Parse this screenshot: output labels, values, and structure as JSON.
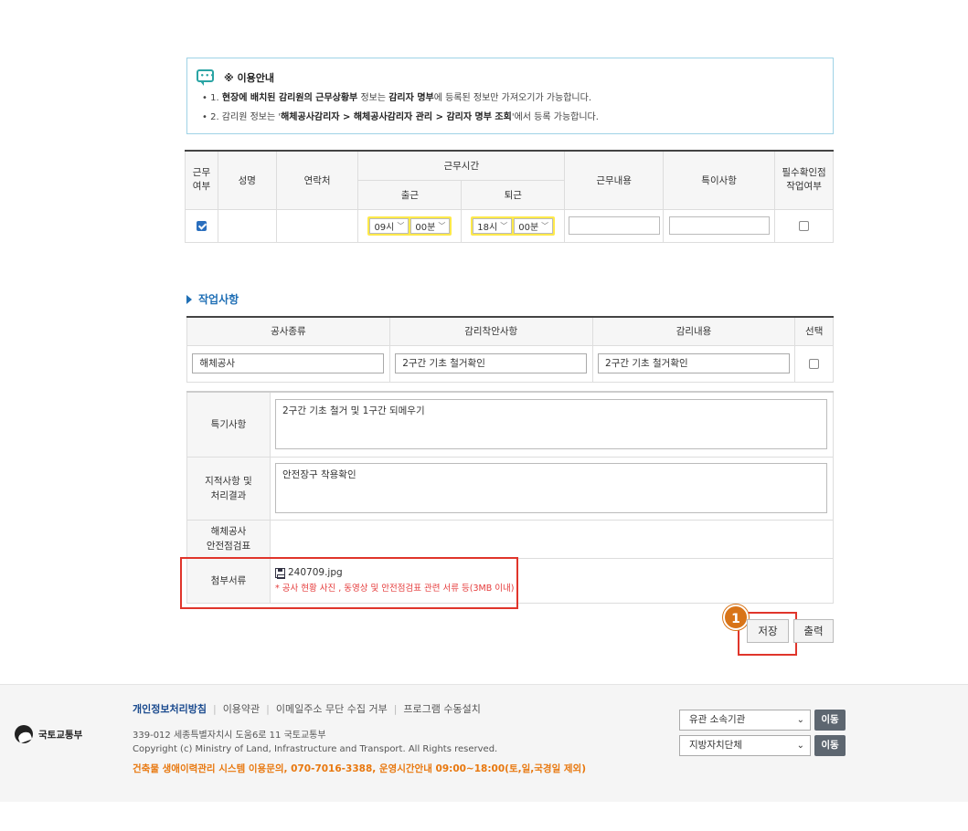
{
  "notice": {
    "title": "※ 이용안내",
    "line1": {
      "prefix": "1. ",
      "b1": "현장에 배치된 감리원의 근무상황부",
      "t1": " 정보는 ",
      "b2": "감리자 명부",
      "t2": "에 등록된 정보만 가져오기가 가능합니다."
    },
    "line2": {
      "prefix": "2. 감리원 정보는 '",
      "b1": "해체공사감리자 > 해체공사감리자 관리 > 감리자 명부 조회",
      "t1": "'에서 등록 가능합니다."
    }
  },
  "worktable": {
    "headers": {
      "work": "근무\n여부",
      "name": "성명",
      "contact": "연락처",
      "time": "근무시간",
      "in": "출근",
      "out": "퇴근",
      "content": "근무내용",
      "special": "특이사항",
      "required": "필수확인점\n작업여부"
    },
    "row": {
      "checked": true,
      "in_hour": "09시",
      "in_min": "00분",
      "out_hour": "18시",
      "out_min": "00분"
    }
  },
  "section_title": "작업사항",
  "tasktable": {
    "headers": [
      "공사종류",
      "감리착안사항",
      "감리내용",
      "선택"
    ],
    "row": [
      "해체공사",
      "2구간 기초 철거확인",
      "2구간 기초 철거확인"
    ]
  },
  "details": {
    "special_label": "특기사항",
    "special_value": "2구간 기초 철거 및 1구간 되메우기",
    "issue_label_1": "지적사항 및",
    "issue_label_2": "처리결과",
    "issue_value": "안전장구 착용확인",
    "safety_label_1": "해체공사",
    "safety_label_2": "안전점검표",
    "attach_label": "첨부서류",
    "file_name": "240709.jpg",
    "file_note": "* 공사 현황 사진 , 동영상 및 안전점검표 관련 서류 등(3MB 이내)"
  },
  "badge": "1",
  "buttons": {
    "save": "저장",
    "print": "출력"
  },
  "footer": {
    "logo_text": "국토교통부",
    "links": [
      "개인정보처리방침",
      "이용약관",
      "이메일주소 무단 수집 거부",
      "프로그램 수동설치"
    ],
    "address": "339-012 세종특별자치시 도움6로 11 국토교통부",
    "copyright": "Copyright (c) Ministry of Land, Infrastructure and Transport. All Rights reserved.",
    "contact": "건축물 생애이력관리 시스템 이용문의, 070-7016-3388, 운영시간안내 09:00~18:00(토,일,국경일 제외)",
    "select1": "유관 소속기관",
    "select2": "지방자치단체",
    "go": "이동"
  },
  "colors": {
    "accent": "#1f6fb5",
    "highlight": "#ffe94a",
    "callout": "#e0352b",
    "badge": "#d87418",
    "contact": "#e8780f"
  }
}
